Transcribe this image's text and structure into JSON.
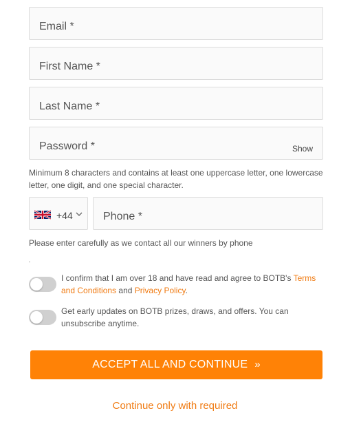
{
  "form": {
    "email_label": "Email *",
    "first_name_label": "First Name *",
    "last_name_label": "Last Name *",
    "password_label": "Password *",
    "show_label": "Show",
    "password_hint": "Minimum 8 characters and contains at least one uppercase letter, one lowercase letter, one digit, and one special character.",
    "country": {
      "flag": "uk-flag-icon",
      "dial_code": "+44"
    },
    "phone_label": "Phone *",
    "phone_hint": "Please enter carefully as we contact all our winners by phone"
  },
  "consents": {
    "terms_prefix": "I confirm that I am over 18 and have read and agree to BOTB's ",
    "terms_link": "Terms and Conditions",
    "terms_and": " and ",
    "privacy_link": "Privacy Policy",
    "terms_suffix": ".",
    "marketing_text": "Get early updates on BOTB prizes, draws, and offers. You can unsubscribe anytime."
  },
  "actions": {
    "accept_all_label": "ACCEPT ALL AND CONTINUE",
    "accept_all_arrows": "»",
    "required_only_label": "Continue only with required"
  },
  "colors": {
    "accent": "#ff8206",
    "link": "#f07b13",
    "toggle_off": "#d0d0d0"
  }
}
